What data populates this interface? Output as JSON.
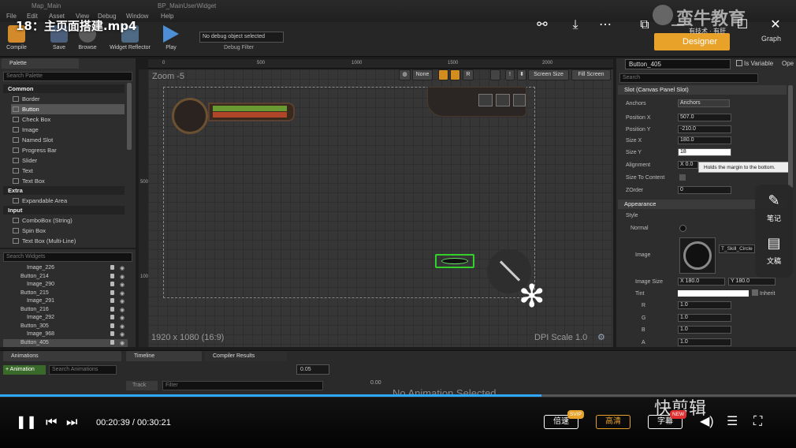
{
  "video": {
    "title": "18：主页面搭建.mp4",
    "time_current": "00:20:39",
    "time_total": "00:30:21",
    "progress": 0.68,
    "speed_label": "倍速",
    "speed_badge": "SVIP",
    "quality_label": "高清",
    "subtitle_label": "字幕",
    "subtitle_badge": "NEW",
    "brand": "快剪辑",
    "side_notes": "笔记",
    "side_doc": "文稿"
  },
  "editor": {
    "window_tabs": [
      "Map_Main",
      "BP_MainUserWidget"
    ],
    "menu": [
      "File",
      "Edit",
      "Asset",
      "View",
      "Debug",
      "Window",
      "Help"
    ],
    "toolbar": {
      "compile": "Compile",
      "save": "Save",
      "browse": "Browse",
      "widget_reflector": "Widget Reflector",
      "play": "Play",
      "debug_select": "No debug object selected",
      "debug_filter": "Debug Filter"
    },
    "logo_text": "蛮牛教育",
    "logo_sub": "有技术 · 有肝",
    "designer": "Designer",
    "graph": "Graph",
    "palette": {
      "tab": "Palette",
      "search_placeholder": "Search Palette",
      "categories": [
        {
          "name": "Common",
          "items": [
            "Border",
            "Button",
            "Check Box",
            "Image",
            "Named Slot",
            "Progress Bar",
            "Slider",
            "Text",
            "Text Box"
          ]
        },
        {
          "name": "Extra",
          "items": [
            "Expandable Area"
          ]
        },
        {
          "name": "Input",
          "items": [
            "ComboBox (String)",
            "Spin Box",
            "Text Box (Multi-Line)"
          ]
        }
      ],
      "selected": "Button"
    },
    "hierarchy": {
      "search_placeholder": "Search Widgets",
      "items": [
        {
          "label": "Image_226",
          "indent": 2
        },
        {
          "label": "Button_214",
          "indent": 1
        },
        {
          "label": "Image_290",
          "indent": 2
        },
        {
          "label": "Button_215",
          "indent": 1
        },
        {
          "label": "Image_291",
          "indent": 2
        },
        {
          "label": "Button_216",
          "indent": 1
        },
        {
          "label": "Image_292",
          "indent": 2
        },
        {
          "label": "Button_305",
          "indent": 1
        },
        {
          "label": "Image_968",
          "indent": 2
        },
        {
          "label": "Button_405",
          "indent": 1,
          "selected": true
        }
      ]
    },
    "canvas": {
      "zoom": "Zoom -5",
      "resolution": "1920 x 1080 (16:9)",
      "dpi": "DPI Scale 1.0",
      "ruler_top": [
        "0",
        "500",
        "1000",
        "1500",
        "2000"
      ],
      "ruler_left": [
        "500",
        "1000"
      ],
      "none_btn": "None",
      "r_btn": "R",
      "screen_size": "Screen Size",
      "fill_screen": "Fill Screen"
    },
    "details": {
      "name": "Button_405",
      "is_variable": "Is Variable",
      "open": "Ope",
      "search_placeholder": "Search",
      "slot_header": "Slot (Canvas Panel Slot)",
      "anchors_label": "Anchors",
      "anchors_value": "Anchors",
      "position_x_label": "Position X",
      "position_x": "507.0",
      "position_y_label": "Position Y",
      "position_y": "-210.0",
      "size_x_label": "Size X",
      "size_x": "180.0",
      "size_y_label": "Size Y",
      "size_y": "18",
      "alignment_label": "Alignment",
      "alignment_x": "X 0.0",
      "size_to_content": "Size To Content",
      "zorder_label": "ZOrder",
      "zorder": "0",
      "appearance_header": "Appearance",
      "style_label": "Style",
      "normal_label": "Normal",
      "image_label": "Image",
      "image_asset": "T_Skill_Circle",
      "image_size_label": "Image Size",
      "image_size_x": "X 180.0",
      "image_size_y": "Y 180.0",
      "tint_label": "Tint",
      "inherit": "Inherit",
      "r_label": "R",
      "r": "1.0",
      "g_label": "G",
      "g": "1.0",
      "b_label": "B",
      "b": "1.0",
      "a_label": "A",
      "a": "1.0",
      "tooltip": "Holds the margin to the bottom."
    },
    "animations": {
      "tab": "Animations",
      "add_btn": "+ Animation",
      "search_placeholder": "Search Animations",
      "timeline_tab": "Timeline",
      "compiler_tab": "Compiler Results",
      "playrate": "0.05",
      "track": "Track",
      "filter": "Filter",
      "time": "0.00",
      "no_selection": "No Animation Selected"
    }
  },
  "colors": {
    "accent": "#e8a22a",
    "progress": "#2ea8ff",
    "selection_green": "#35d12b"
  }
}
